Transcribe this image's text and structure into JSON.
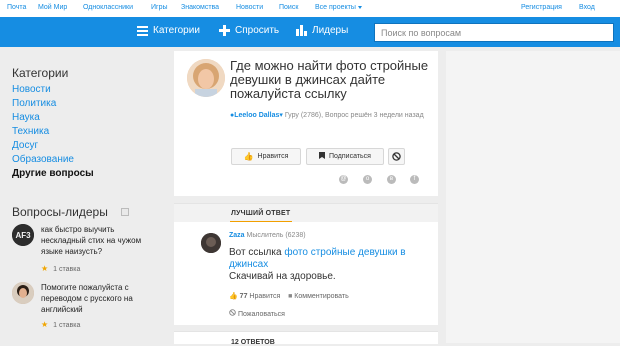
{
  "top_nav": {
    "links": [
      "Почта",
      "Мой Мир",
      "Одноклассники",
      "Игры",
      "Знакомства",
      "Новости",
      "Поиск"
    ],
    "all_projects": "Все проекты",
    "register": "Регистрация",
    "login": "Вход"
  },
  "header": {
    "categories": "Категории",
    "ask": "Спросить",
    "leaders": "Лидеры",
    "search_placeholder": "Поиск по вопросам"
  },
  "sidebar": {
    "title": "Категории",
    "categories": [
      {
        "label": "Новости",
        "active": false
      },
      {
        "label": "Политика",
        "active": false
      },
      {
        "label": "Наука",
        "active": false
      },
      {
        "label": "Техника",
        "active": false
      },
      {
        "label": "Досуг",
        "active": false
      },
      {
        "label": "Образование",
        "active": false
      },
      {
        "label": "Другие вопросы",
        "active": true
      }
    ],
    "leaders_title": "Вопросы-лидеры",
    "leader_questions": [
      {
        "text": "как быстро выучить нескладный стих на чужом языке наизусть?",
        "stake": "1 ставка",
        "avatar_label": "AF3"
      },
      {
        "text": "Помогите пожалуйста с переводом с русского на английский",
        "stake": "1 ставка"
      }
    ]
  },
  "question": {
    "title": "Где можно найти фото стройные девушки в джинсах дайте пожалуйста ссылку",
    "author": "Leeloo Dallas",
    "author_meta": "Гуру (2786), Вопрос решён 3 недели назад",
    "like_button": "Нравится",
    "subscribe_button": "Подписаться"
  },
  "best_answer": {
    "section_label": "ЛУЧШИЙ ОТВЕТ",
    "author": "Zaza",
    "author_meta": "Мыслитель (6238)",
    "text_prefix": "Вот ссылка",
    "link_text": "фото стройные девушки в джинсах",
    "text_suffix": "Скачивай на здоровье.",
    "likes": "77",
    "like_label": "Нравится",
    "comment_label": "Комментировать",
    "complain_label": "Пожаловаться"
  },
  "answers_count": "12 ОТВЕТОВ",
  "colors": {
    "brand_blue": "#168de2",
    "accent_orange": "#f29f00"
  }
}
